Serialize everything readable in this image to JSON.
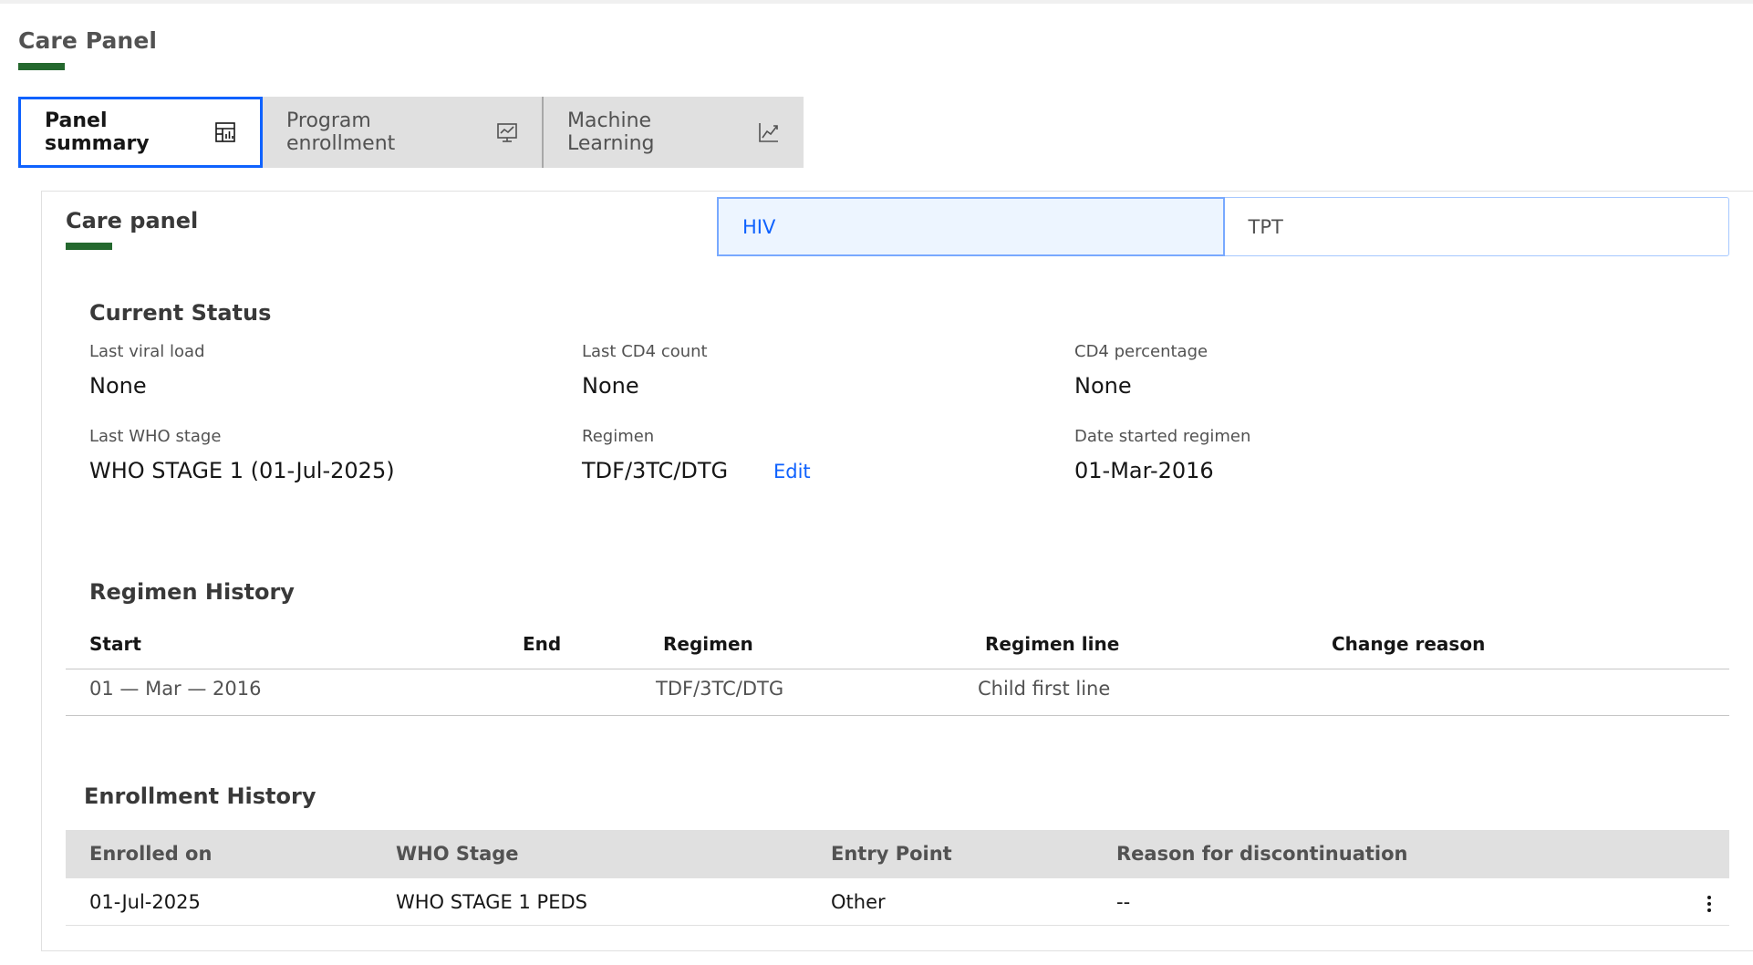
{
  "page": {
    "title": "Care Panel"
  },
  "tabs": [
    {
      "label": "Panel summary",
      "icon": "table-chart-icon",
      "active": true
    },
    {
      "label": "Program enrollment",
      "icon": "monitor-chart-icon",
      "active": false
    },
    {
      "label": "Machine Learning",
      "icon": "line-chart-icon",
      "active": false
    }
  ],
  "panel": {
    "title": "Care panel",
    "switcher": [
      {
        "label": "HIV",
        "active": true
      },
      {
        "label": "TPT",
        "active": false
      }
    ]
  },
  "current_status": {
    "title": "Current Status",
    "last_viral_load": {
      "label": "Last viral load",
      "value": "None"
    },
    "last_cd4_count": {
      "label": "Last CD4 count",
      "value": "None"
    },
    "cd4_percentage": {
      "label": "CD4 percentage",
      "value": "None"
    },
    "last_who_stage": {
      "label": "Last WHO stage",
      "value": "WHO STAGE 1 (01-Jul-2025)"
    },
    "regimen": {
      "label": "Regimen",
      "value": "TDF/3TC/DTG",
      "edit_label": "Edit"
    },
    "date_started_regimen": {
      "label": "Date started regimen",
      "value": "01-Mar-2016"
    }
  },
  "regimen_history": {
    "title": "Regimen History",
    "columns": [
      "Start",
      "End",
      "Regimen",
      "Regimen line",
      "Change reason"
    ],
    "rows": [
      {
        "start": "01 — Mar — 2016",
        "end": "",
        "regimen": "TDF/3TC/DTG",
        "regimen_line": "Child first line",
        "change_reason": ""
      }
    ]
  },
  "enrollment_history": {
    "title": "Enrollment History",
    "columns": [
      "Enrolled on",
      "WHO Stage",
      "Entry Point",
      "Reason for discontinuation"
    ],
    "rows": [
      {
        "enrolled_on": "01-Jul-2025",
        "who_stage": "WHO STAGE 1 PEDS",
        "entry_point": "Other",
        "reason": "--"
      }
    ]
  },
  "colors": {
    "accent_green": "#24682e",
    "focus_blue": "#0f62fe",
    "tab_gray": "#e0e0e0"
  }
}
